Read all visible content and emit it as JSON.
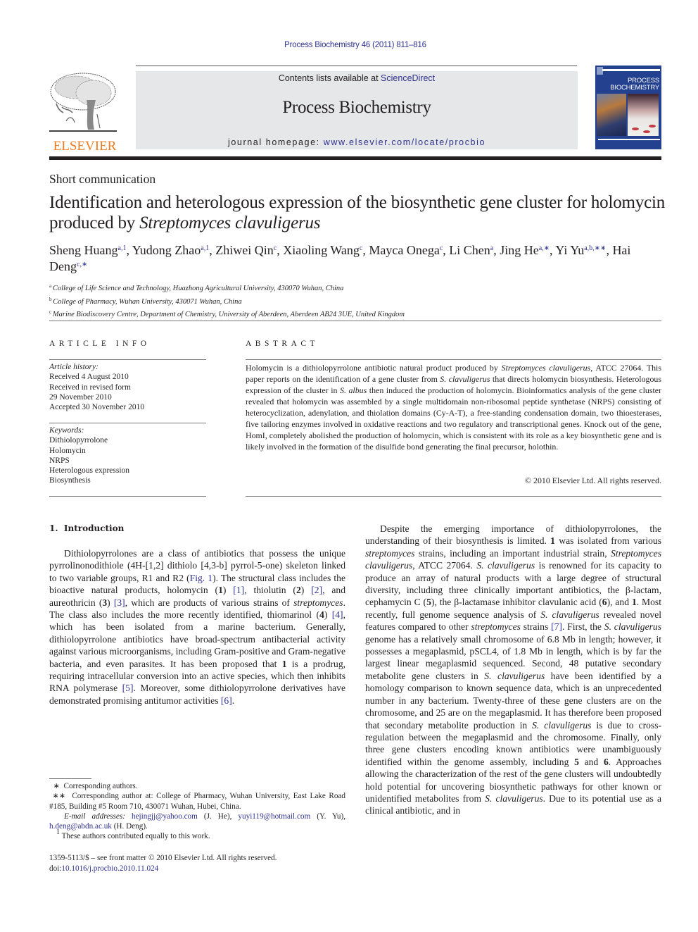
{
  "header": {
    "journal_ref": "Process Biochemistry 46 (2011) 811–816",
    "contents_prefix": "Contents lists available at ",
    "contents_link": "ScienceDirect",
    "journal_title": "Process Biochemistry",
    "homepage_prefix": "journal homepage: ",
    "homepage_link": "www.elsevier.com/locate/procbio",
    "publisher_wordmark": "ELSEVIER",
    "cover_title_line1": "PROCESS",
    "cover_title_line2": "BIOCHEMISTRY",
    "colors": {
      "link": "#2e3191",
      "elsevier_orange": "#f07d21",
      "masthead_bg": "#e6e7e8",
      "cover_blue": "#24418f"
    }
  },
  "article": {
    "type": "Short communication",
    "title_plain": "Identification and heterologous expression of the biosynthetic gene cluster for holomycin produced by ",
    "title_italic": "Streptomyces clavuligerus",
    "authors": [
      {
        "name": "Sheng Huang",
        "sup": "a,1",
        "sep": ", "
      },
      {
        "name": "Yudong Zhao",
        "sup": "a,1",
        "sep": ", "
      },
      {
        "name": "Zhiwei Qin",
        "sup": "c",
        "sep": ", "
      },
      {
        "name": "Xiaoling Wang",
        "sup": "c",
        "sep": ", "
      },
      {
        "name": "Mayca Onega",
        "sup": "c",
        "sep": ", "
      },
      {
        "name": "Li Chen",
        "sup": "a",
        "sep": ", "
      },
      {
        "name": "Jing He",
        "sup": "a,∗",
        "sep": ", "
      },
      {
        "name": "Yi Yu",
        "sup": "a,b,∗∗",
        "sep": ", "
      },
      {
        "name": "Hai Deng",
        "sup": "c,∗",
        "sep": ""
      }
    ],
    "affiliations": [
      {
        "label": "a",
        "text": "College of Life Science and Technology, Huazhong Agricultural University, 430070 Wuhan, China"
      },
      {
        "label": "b",
        "text": "College of Pharmacy, Wuhan University, 430071 Wuhan, China"
      },
      {
        "label": "c",
        "text": "Marine Biodiscovery Centre, Department of Chemistry, University of Aberdeen, Aberdeen AB24 3UE, United Kingdom"
      }
    ]
  },
  "article_info": {
    "heading": "ARTICLE INFO",
    "history_label": "Article history:",
    "history": [
      "Received 4 August 2010",
      "Received in revised form",
      "29 November 2010",
      "Accepted 30 November 2010"
    ],
    "keywords_label": "Keywords:",
    "keywords": [
      "Dithiolopyrrolone",
      "Holomycin",
      "NRPS",
      "Heterologous expression",
      "Biosynthesis"
    ]
  },
  "abstract": {
    "heading": "ABSTRACT",
    "segments": [
      {
        "t": "Holomycin is a dithiolopyrrolone antibiotic natural product produced by "
      },
      {
        "t": "Streptomyces clavuligerus",
        "i": true
      },
      {
        "t": ", ATCC 27064. This paper reports on the identification of a gene cluster from "
      },
      {
        "t": "S. clavuligerus",
        "i": true
      },
      {
        "t": " that directs holomycin biosynthesis. Heterologous expression of the cluster in "
      },
      {
        "t": "S. albus",
        "i": true
      },
      {
        "t": " then induced the production of holomycin. Bioinformatics analysis of the gene cluster revealed that holomycin was assembled by a single multidomain non-ribosomal peptide synthetase (NRPS) consisting of heterocyclization, adenylation, and thiolation domains (Cy-A-T), a free-standing condensation domain, two thioesterases, five tailoring enzymes involved in oxidative reactions and two regulatory and transcriptional genes. Knock out of the gene, HomI, completely abolished the production of holomycin, which is consistent with its role as a key biosynthetic gene and is likely involved in the formation of the disulfide bond generating the final precursor, holothin."
      }
    ],
    "copyright": "© 2010 Elsevier Ltd. All rights reserved."
  },
  "body": {
    "intro_heading": "1.  Introduction",
    "left_paragraph": [
      {
        "t": "Dithiolopyrrolones are a class of antibiotics that possess the unique pyrrolinonodithiole (4H-[1,2] dithiolo [4,3-b] pyrrol-5-one) skeleton linked to two variable groups, R1 and R2 ("
      },
      {
        "t": "Fig. 1",
        "link": true
      },
      {
        "t": "). The structural class includes the bioactive natural products, holomycin ("
      },
      {
        "t": "1",
        "b": true
      },
      {
        "t": ") "
      },
      {
        "t": "[1]",
        "link": true
      },
      {
        "t": ", thiolutin ("
      },
      {
        "t": "2",
        "b": true
      },
      {
        "t": ") "
      },
      {
        "t": "[2]",
        "link": true
      },
      {
        "t": ", and aureothricin ("
      },
      {
        "t": "3",
        "b": true
      },
      {
        "t": ") "
      },
      {
        "t": "[3]",
        "link": true
      },
      {
        "t": ", which are products of various strains of "
      },
      {
        "t": "streptomyces",
        "i": true
      },
      {
        "t": ". The class also includes the more recently identified, thiomarinol ("
      },
      {
        "t": "4",
        "b": true
      },
      {
        "t": ") "
      },
      {
        "t": "[4]",
        "link": true
      },
      {
        "t": ", which has been isolated from a marine bacterium. Generally, dithiolopyrrolone antibiotics have broad-spectrum antibacterial activity against various microorganisms, including Gram-positive and Gram-negative bacteria, and even parasites. It has been proposed that "
      },
      {
        "t": "1",
        "b": true
      },
      {
        "t": " is a prodrug, requiring intracellular conversion into an active species, which then inhibits RNA polymerase "
      },
      {
        "t": "[5]",
        "link": true
      },
      {
        "t": ". Moreover, some dithiolopyrrolone derivatives have demonstrated promising antitumor activities "
      },
      {
        "t": "[6]",
        "link": true
      },
      {
        "t": "."
      }
    ],
    "right_paragraph": [
      {
        "t": "Despite the emerging importance of dithiolopyrrolones, the understanding of their biosynthesis is limited. "
      },
      {
        "t": "1",
        "b": true
      },
      {
        "t": " was isolated from various "
      },
      {
        "t": "streptomyces",
        "i": true
      },
      {
        "t": " strains, including an important industrial strain, "
      },
      {
        "t": "Streptomyces clavuligerus",
        "i": true
      },
      {
        "t": ", ATCC 27064. "
      },
      {
        "t": "S. clavuligerus",
        "i": true
      },
      {
        "t": " is renowned for its capacity to produce an array of natural products with a large degree of structural diversity, including three clinically important antibiotics, the β-lactam, cephamycin C ("
      },
      {
        "t": "5",
        "b": true
      },
      {
        "t": "), the β-lactamase inhibitor clavulanic acid ("
      },
      {
        "t": "6",
        "b": true
      },
      {
        "t": "), and "
      },
      {
        "t": "1",
        "b": true
      },
      {
        "t": ". Most recently, full genome sequence analysis of "
      },
      {
        "t": "S. clavuligerus",
        "i": true
      },
      {
        "t": " revealed novel features compared to other "
      },
      {
        "t": "streptomyces",
        "i": true
      },
      {
        "t": " strains "
      },
      {
        "t": "[7]",
        "link": true
      },
      {
        "t": ". First, the "
      },
      {
        "t": "S. clavuligerus",
        "i": true
      },
      {
        "t": " genome has a relatively small chromosome of 6.8 Mb in length; however, it possesses a megaplasmid, pSCL4, of 1.8 Mb in length, which is by far the largest linear megaplasmid sequenced. Second, 48 putative secondary metabolite gene clusters in "
      },
      {
        "t": "S. clavuligerus",
        "i": true
      },
      {
        "t": " have been identified by a homology comparison to known sequence data, which is an unprecedented number in any bacterium. Twenty-three of these gene clusters are on the chromosome, and 25 are on the megaplasmid. It has therefore been proposed that secondary metabolite production in "
      },
      {
        "t": "S. clavuligerus",
        "i": true
      },
      {
        "t": " is due to cross-regulation between the megaplasmid and the chromosome. Finally, only three gene clusters encoding known antibiotics were unambiguously identified within the genome assembly, including "
      },
      {
        "t": "5",
        "b": true
      },
      {
        "t": " and "
      },
      {
        "t": "6",
        "b": true
      },
      {
        "t": ". Approaches allowing the characterization of the rest of the gene clusters will undoubtedly hold potential for uncovering biosynthetic pathways for other known or unidentified metabolites from "
      },
      {
        "t": "S. clavuligerus",
        "i": true
      },
      {
        "t": ". Due to its potential use as a clinical antibiotic, and in"
      }
    ]
  },
  "footnotes": {
    "corresponding": "  ∗  Corresponding authors.",
    "corresponding_at": " ∗∗  Corresponding author at: College of Pharmacy, Wuhan University, East Lake Road #185, Building #5 Room 710, 430071 Wuhan, Hubei, China.",
    "email_label": "E-mail addresses:",
    "emails": [
      {
        "address": "hejingjj@yahoo.com",
        "who": " (J. He), "
      },
      {
        "address": "yuyi119@hotmail.com",
        "who": " (Y. Yu), "
      },
      {
        "address": "h.deng@abdn.ac.uk",
        "who": " (H. Deng)."
      }
    ],
    "equal_contrib_label": "1",
    "equal_contrib": " These authors contributed equally to this work.",
    "issn_line": "1359-5113/$ – see front matter © 2010 Elsevier Ltd. All rights reserved.",
    "doi_prefix": "doi:",
    "doi": "10.1016/j.procbio.2010.11.024"
  }
}
